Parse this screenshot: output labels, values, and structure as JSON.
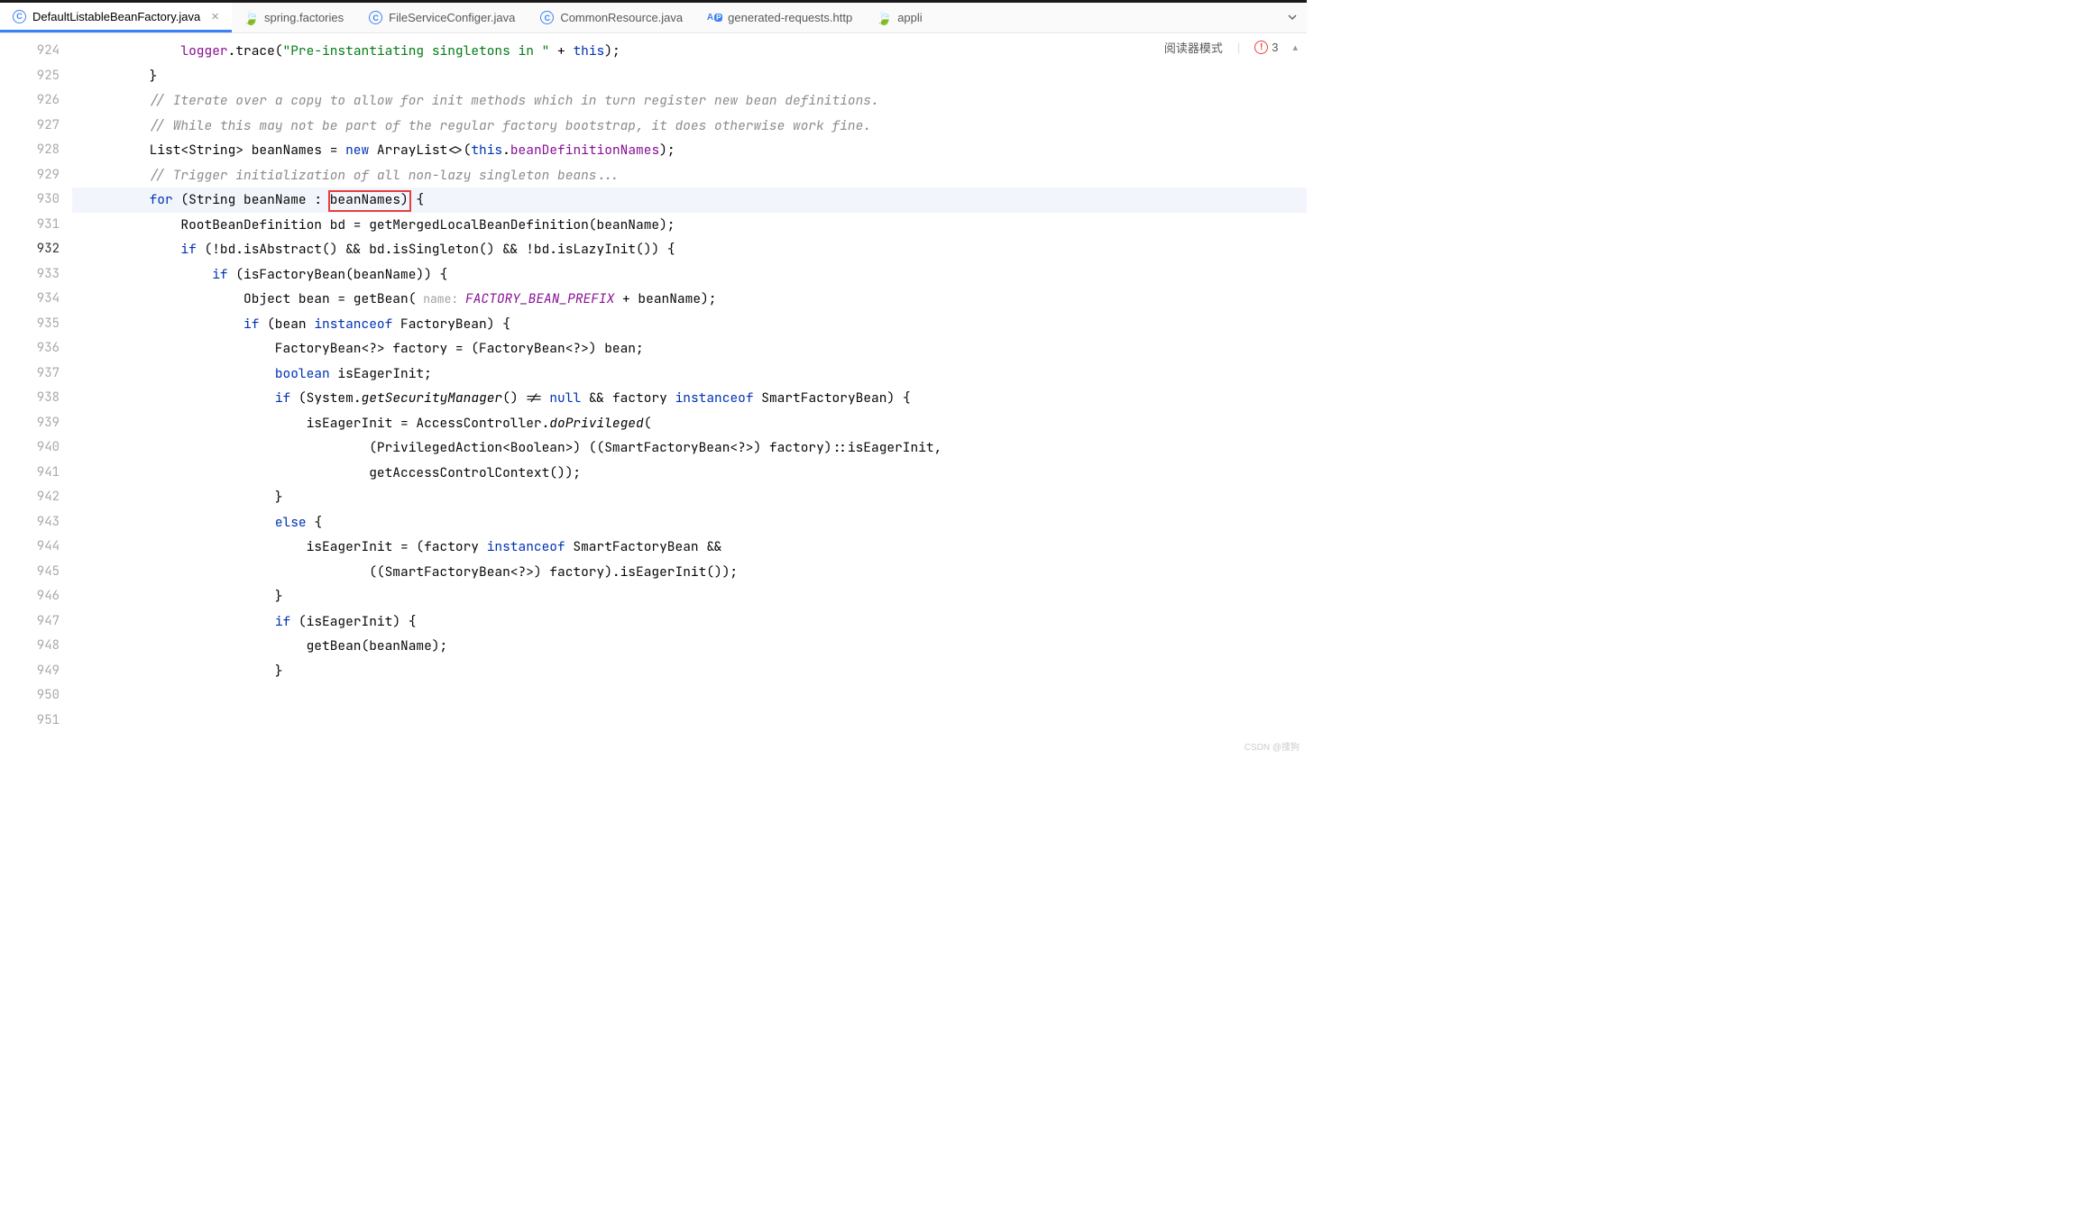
{
  "tabs": {
    "active": "DefaultListableBeanFactory.java",
    "items": [
      {
        "label": "DefaultListableBeanFactory.java",
        "icon": "java-class"
      },
      {
        "label": "spring.factories",
        "icon": "spring-leaf"
      },
      {
        "label": "FileServiceConfiger.java",
        "icon": "java-class"
      },
      {
        "label": "CommonResource.java",
        "icon": "java-class"
      },
      {
        "label": "generated-requests.http",
        "icon": "http"
      },
      {
        "label": "appli",
        "icon": "spring-leaf"
      }
    ]
  },
  "topRight": {
    "readerMode": "阅读器模式",
    "errorCount": "3"
  },
  "gutter": {
    "start": 924,
    "end": 951,
    "current": 932
  },
  "code": {
    "l924": {
      "pre": "            ",
      "v1": "logger",
      "v2": ".trace(",
      "s": "\"Pre-instantiating singletons in \"",
      "v3": " + ",
      "kw": "this",
      "v4": ");"
    },
    "l925": "        }",
    "l926": "",
    "l927": {
      "pre": "        ",
      "c": "// Iterate over a copy to allow for init methods which in turn register new bean definitions."
    },
    "l928": {
      "pre": "        ",
      "c": "// While this may not be part of the regular factory bootstrap, it does otherwise work fine."
    },
    "l929": {
      "pre": "        ",
      "t1": "List<String> beanNames = ",
      "kw1": "new",
      "t2": " ArrayList<>(",
      "kw2": "this",
      "t3": ".",
      "f": "beanDefinitionNames",
      "t4": ");"
    },
    "l930": "",
    "l931": {
      "pre": "        ",
      "c": "// Trigger initialization of all non-lazy singleton beans..."
    },
    "l932": {
      "pre": "        ",
      "kw": "for",
      "t1": " (String beanName : ",
      "box": "beanNames)",
      "t2": " {"
    },
    "l933": "            RootBeanDefinition bd = getMergedLocalBeanDefinition(beanName);",
    "l934": {
      "pre": "            ",
      "kw": "if",
      "t": " (!bd.isAbstract() && bd.isSingleton() && !bd.isLazyInit()) {"
    },
    "l935": {
      "pre": "                ",
      "kw": "if",
      "t": " (isFactoryBean(beanName)) {"
    },
    "l936": {
      "pre": "                    ",
      "t1": "Object bean = getBean(",
      "h": " name: ",
      "c": "FACTORY_BEAN_PREFIX",
      "t2": " + beanName);"
    },
    "l937": {
      "pre": "                    ",
      "kw1": "if",
      "t1": " (bean ",
      "kw2": "instanceof",
      "t2": " FactoryBean) {"
    },
    "l938": "                        FactoryBean<?> factory = (FactoryBean<?>) bean;",
    "l939": {
      "pre": "                        ",
      "kw": "boolean",
      "t": " isEagerInit;"
    },
    "l940": {
      "pre": "                        ",
      "kw1": "if",
      "t1": " (System.",
      "m": "getSecurityManager",
      "t2": "() != ",
      "kw2": "null",
      "t3": " && factory ",
      "kw3": "instanceof",
      "t4": " SmartFactoryBean) {"
    },
    "l941": {
      "pre": "                            ",
      "t1": "isEagerInit = AccessController.",
      "m": "doPrivileged",
      "t2": "("
    },
    "l942": "                                    (PrivilegedAction<Boolean>) ((SmartFactoryBean<?>) factory)::isEagerInit,",
    "l943": "                                    getAccessControlContext());",
    "l944": "                        }",
    "l945": {
      "pre": "                        ",
      "kw": "else",
      "t": " {"
    },
    "l946": {
      "pre": "                            ",
      "t1": "isEagerInit = (factory ",
      "kw": "instanceof",
      "t2": " SmartFactoryBean &&"
    },
    "l947": "                                    ((SmartFactoryBean<?>) factory).isEagerInit());",
    "l948": "                        }",
    "l949": {
      "pre": "                        ",
      "kw": "if",
      "t": " (isEagerInit) {"
    },
    "l950": "                            getBean(beanName);",
    "l951": "                        }"
  },
  "watermark": "CSDN @搜狗"
}
